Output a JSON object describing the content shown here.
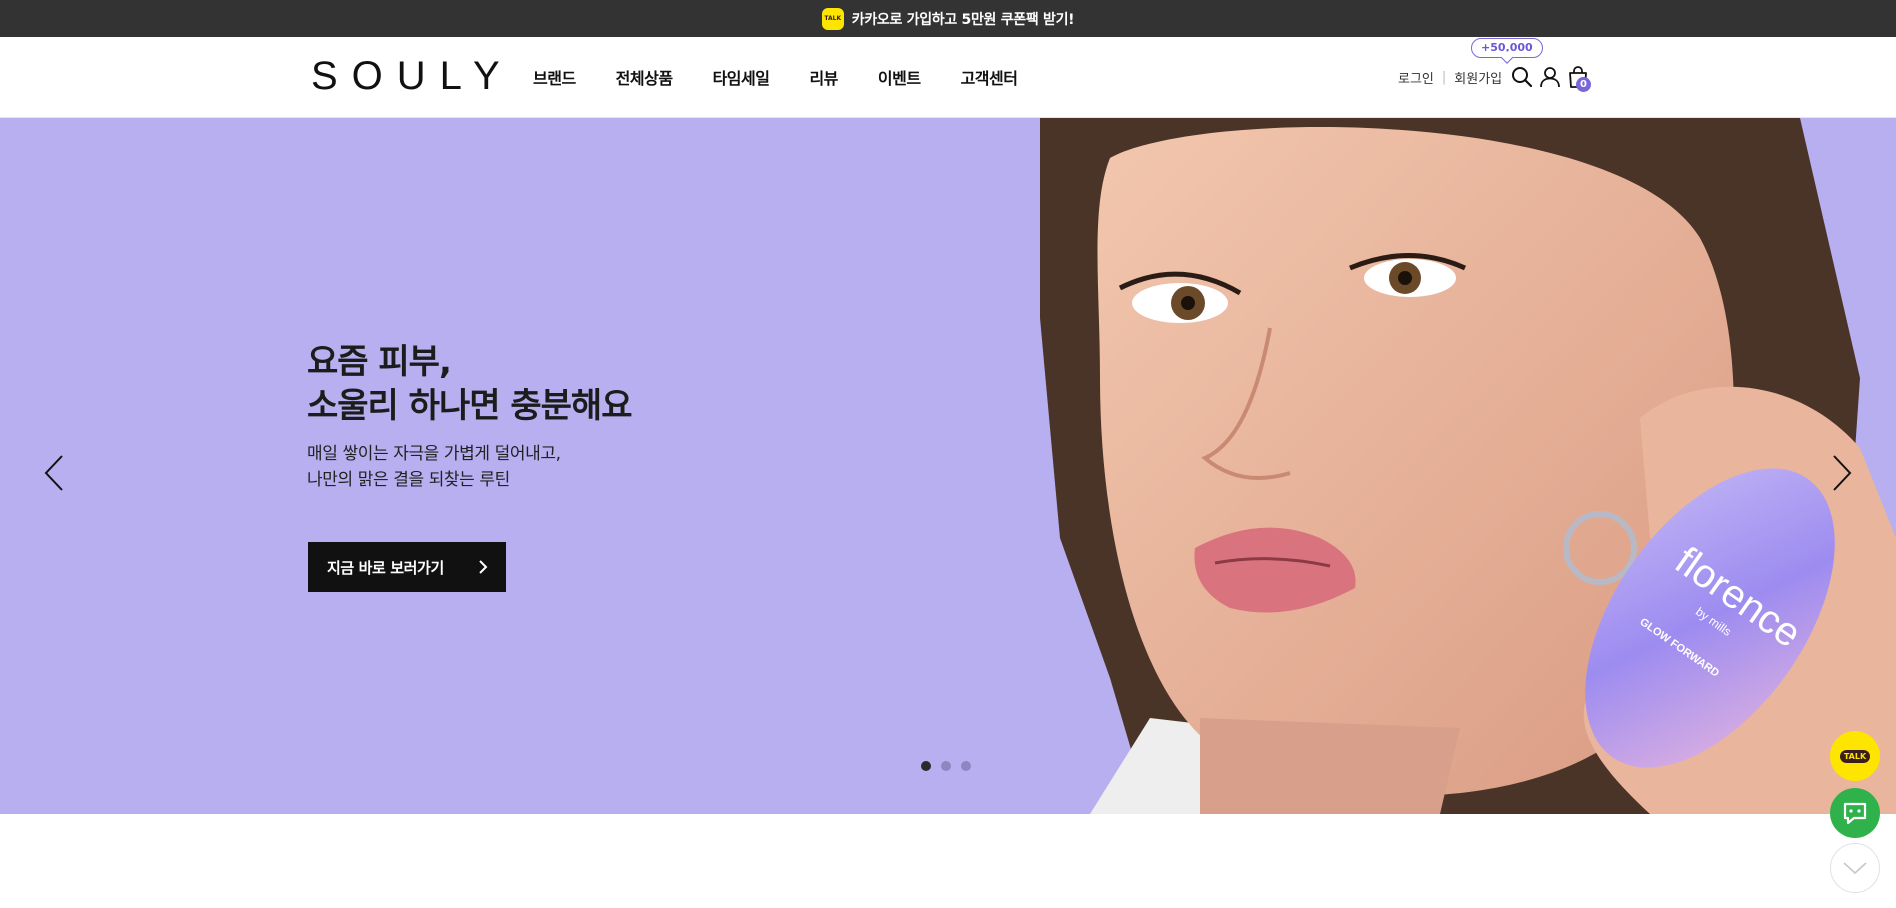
{
  "promo": {
    "badge": "TALK",
    "text": "카카오로 가입하고 5만원 쿠폰팩 받기!"
  },
  "header": {
    "logo": "SOULY",
    "nav": [
      "브랜드",
      "전체상품",
      "타임세일",
      "리뷰",
      "이벤트",
      "고객센터"
    ],
    "login": "로그인",
    "signup": "회원가입",
    "points_badge": "+50,000",
    "cart_count": "0",
    "icons": [
      "search-icon",
      "user-icon",
      "shopping-bag-icon"
    ]
  },
  "hero": {
    "headline_line1": "요즘 피부,",
    "headline_line2": "소울리 하나면 충분해요",
    "sub_line1": "매일 쌓이는 자극을 가볍게 덜어내고,",
    "sub_line2": "나만의 맑은 결을 되찾는 루틴",
    "cta": "지금 바로 보러가기",
    "product_brand": "florence",
    "product_sub": "by mills",
    "product_name": "GLOW FORWARD",
    "slides_total": 3,
    "active_slide": 1,
    "background_color": "#b7aff0"
  },
  "floating": {
    "kakao_label": "TALK",
    "icons": [
      "kakao-talk-icon",
      "chat-icon",
      "chevron-down-icon"
    ]
  }
}
